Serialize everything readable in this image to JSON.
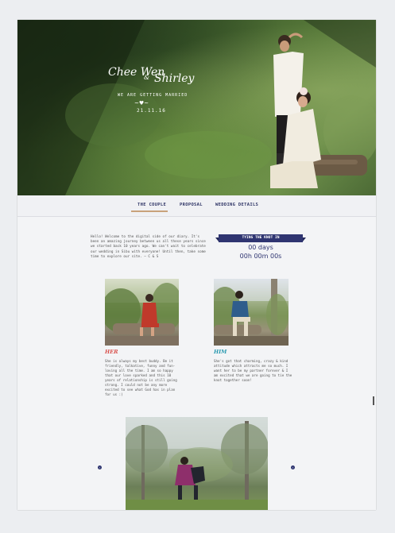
{
  "hero": {
    "name_first": "Chee Wen",
    "ampersand": "&",
    "name_second": "Shirley",
    "tagline": "WE ARE GETTING MARRIED",
    "ornament": "~♥~",
    "date": "21.11.16"
  },
  "nav": {
    "items": [
      {
        "label": "THE COUPLE"
      },
      {
        "label": "PROPOSAL"
      },
      {
        "label": "WEDDING DETAILS"
      }
    ],
    "active_index": 0
  },
  "intro": {
    "text": "Hello! Welcome to the digital side of our diary. It's been an amazing journey between us all these years since we started back 10 years ago. We can't wait to celebrate our wedding in Sibu with everyone! Until then, take some time to explore our site. — C & S"
  },
  "countdown": {
    "heading": "TYING THE KNOT IN",
    "days": "00 days",
    "time": "00h 00m 00s"
  },
  "her": {
    "label": "HER",
    "bio": "She is always my best buddy. Be it friendly, talkative, funny and fun-loving all the time. I am so happy that our love sparked and this 10 years of relationship is still going strong. I could not be any more excited to see what God has in plan for us :)"
  },
  "him": {
    "label": "HIM",
    "bio": "She's got that charming, crazy & kind attitude which attracts me so much. I want her to be my partner forever & I am excited that we are going to tie the knot together soon!"
  },
  "carousel": {
    "prev_icon": "‹",
    "next_icon": "›"
  },
  "colors": {
    "accent": "#2f3571",
    "her": "#d9534f",
    "him": "#2a9ab0",
    "nav_underline": "#c9a27b"
  }
}
